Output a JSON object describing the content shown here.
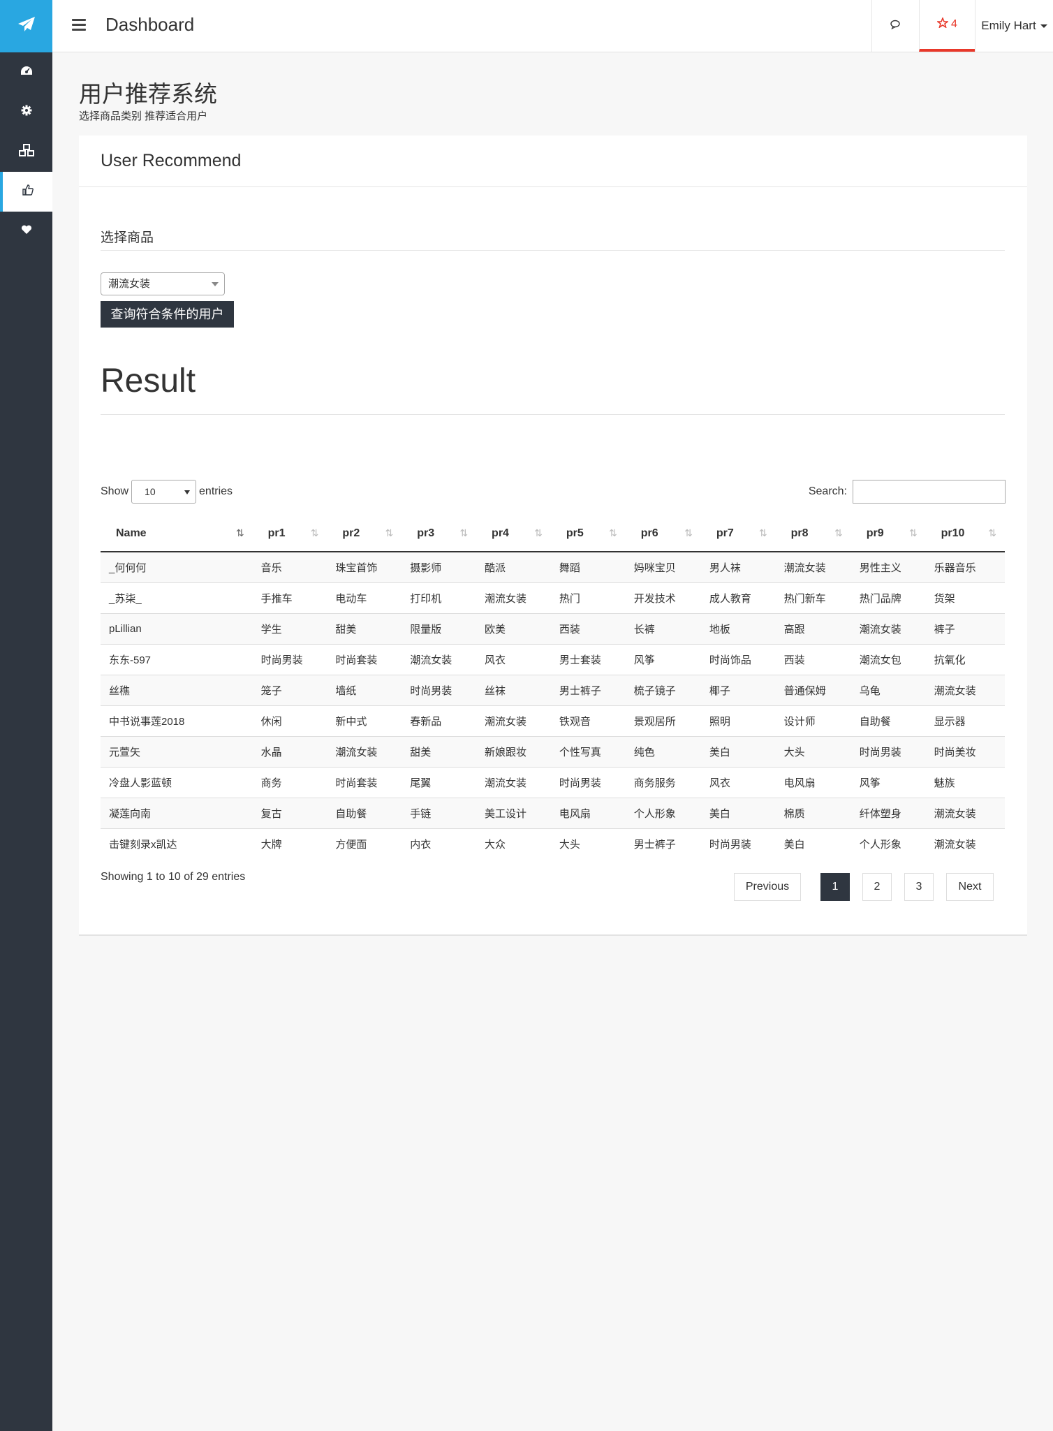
{
  "topbar": {
    "title": "Dashboard",
    "notification_count": "4",
    "user_name": "Emily Hart"
  },
  "page": {
    "title": "用户推荐系统",
    "subtitle": "选择商品类别 推荐适合用户"
  },
  "panel": {
    "title": "User Recommend",
    "section_label": "选择商品",
    "category_select": {
      "value": "潮流女装"
    },
    "query_button": "查询符合条件的用户",
    "result_title": "Result"
  },
  "table_controls": {
    "show_label": "Show",
    "page_length": "10",
    "entries_label": "entries",
    "search_label": "Search:",
    "search_value": ""
  },
  "table": {
    "columns": [
      "Name",
      "pr1",
      "pr2",
      "pr3",
      "pr4",
      "pr5",
      "pr6",
      "pr7",
      "pr8",
      "pr9",
      "pr10"
    ],
    "rows": [
      [
        "_何何何",
        "音乐",
        "珠宝首饰",
        "摄影师",
        "酷派",
        "舞蹈",
        "妈咪宝贝",
        "男人袜",
        "潮流女装",
        "男性主义",
        "乐器音乐"
      ],
      [
        "_苏柒_",
        "手推车",
        "电动车",
        "打印机",
        "潮流女装",
        "热门",
        "开发技术",
        "成人教育",
        "热门新车",
        "热门品牌",
        "货架"
      ],
      [
        "pLillian",
        "学生",
        "甜美",
        "限量版",
        "欧美",
        "西装",
        "长裤",
        "地板",
        "高跟",
        "潮流女装",
        "裤子"
      ],
      [
        "东东-597",
        "时尚男装",
        "时尚套装",
        "潮流女装",
        "风衣",
        "男士套装",
        "风筝",
        "时尚饰品",
        "西装",
        "潮流女包",
        "抗氧化"
      ],
      [
        "丝穛",
        "笼子",
        "墙纸",
        "时尚男装",
        "丝袜",
        "男士裤子",
        "梳子镜子",
        "椰子",
        "普通保姆",
        "乌龟",
        "潮流女装"
      ],
      [
        "中书说事莲2018",
        "休闲",
        "新中式",
        "春新品",
        "潮流女装",
        "铁观音",
        "景观居所",
        "照明",
        "设计师",
        "自助餐",
        "显示器"
      ],
      [
        "元萱矢",
        "水晶",
        "潮流女装",
        "甜美",
        "新娘跟妆",
        "个性写真",
        "纯色",
        "美白",
        "大头",
        "时尚男装",
        "时尚美妆"
      ],
      [
        "冷盘人影蓝顿",
        "商务",
        "时尚套装",
        "尾翼",
        "潮流女装",
        "时尚男装",
        "商务服务",
        "风衣",
        "电风扇",
        "风筝",
        "魅族"
      ],
      [
        "凝莲向南",
        "复古",
        "自助餐",
        "手链",
        "美工设计",
        "电风扇",
        "个人形象",
        "美白",
        "棉质",
        "纤体塑身",
        "潮流女装"
      ],
      [
        "击键刻录x凯达",
        "大牌",
        "方便面",
        "内衣",
        "大众",
        "大头",
        "男士裤子",
        "时尚男装",
        "美白",
        "个人形象",
        "潮流女装"
      ]
    ]
  },
  "pagination": {
    "info": "Showing 1 to 10 of 29 entries",
    "previous": "Previous",
    "next": "Next",
    "pages": [
      "1",
      "2",
      "3"
    ],
    "current_page": "1"
  },
  "colors": {
    "sidebar": "#2f3640",
    "brand": "#29a7e1",
    "alert": "#e8382a"
  }
}
